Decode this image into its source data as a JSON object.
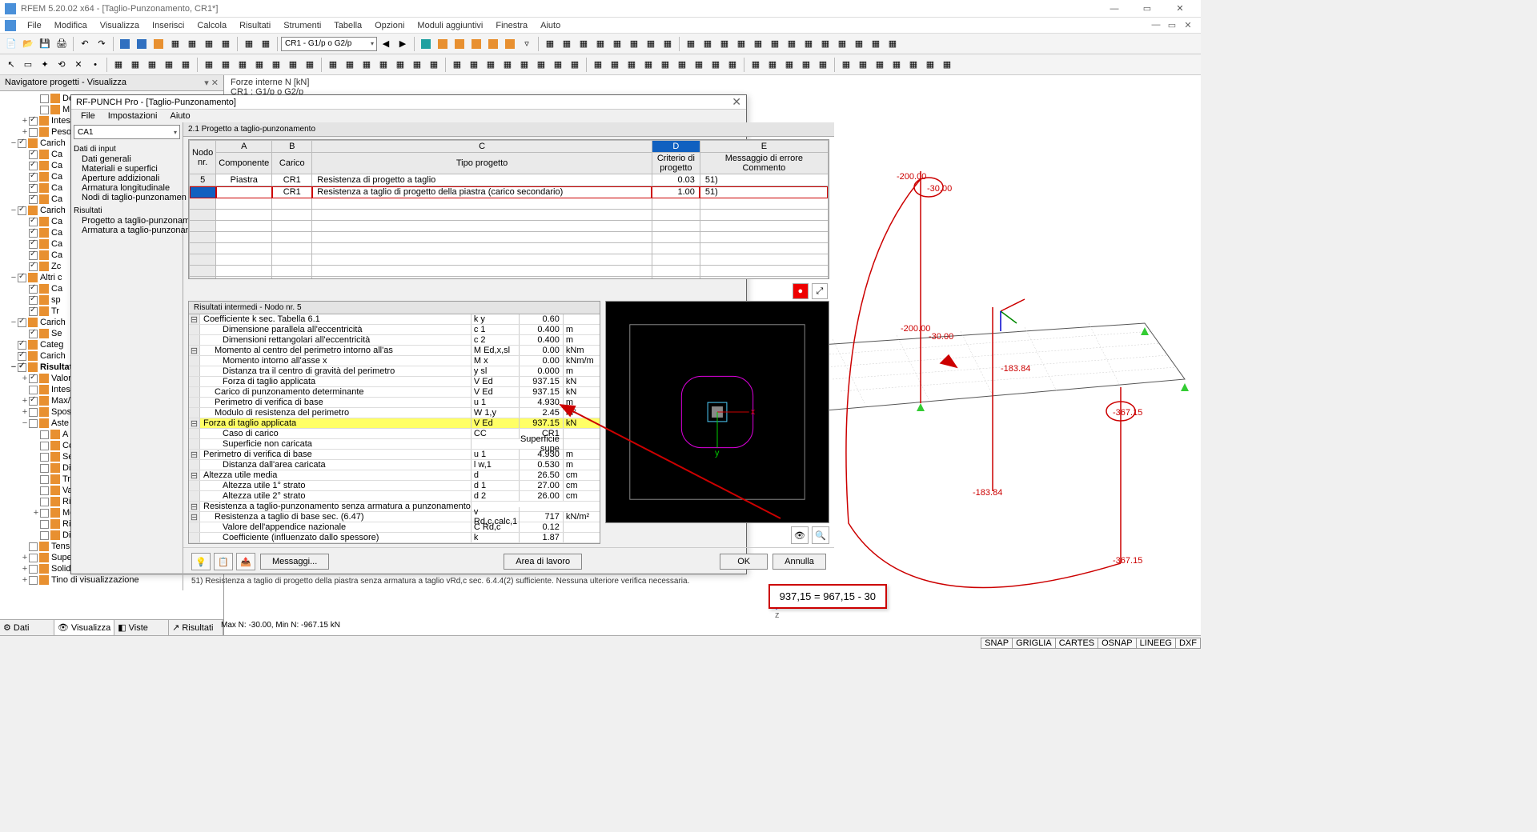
{
  "app": {
    "title": "RFEM 5.20.02 x64 - [Taglio-Punzonamento, CR1*]"
  },
  "menu": [
    "File",
    "Modifica",
    "Visualizza",
    "Inserisci",
    "Calcola",
    "Risultati",
    "Strumenti",
    "Tabella",
    "Opzioni",
    "Moduli aggiuntivi",
    "Finestra",
    "Aiuto"
  ],
  "toolbar_combo": "CR1 - G1/p o G2/p",
  "navigator": {
    "title": "Navigatore progetti - Visualizza",
    "items": [
      {
        "lvl": 2,
        "chk": false,
        "label": "Descrizione dei casi di carico"
      },
      {
        "lvl": 2,
        "chk": false,
        "label": "M"
      },
      {
        "lvl": 1,
        "chk": true,
        "label": "Intest",
        "exp": "+"
      },
      {
        "lvl": 1,
        "chk": false,
        "label": "Peso",
        "exp": "+"
      },
      {
        "lvl": 0,
        "chk": true,
        "label": "Carich",
        "exp": "−"
      },
      {
        "lvl": 1,
        "chk": true,
        "label": "Ca"
      },
      {
        "lvl": 1,
        "chk": true,
        "label": "Ca"
      },
      {
        "lvl": 1,
        "chk": true,
        "label": "Ca"
      },
      {
        "lvl": 1,
        "chk": true,
        "label": "Ca"
      },
      {
        "lvl": 1,
        "chk": true,
        "label": "Ca"
      },
      {
        "lvl": 0,
        "chk": true,
        "label": "Carich",
        "exp": "−"
      },
      {
        "lvl": 1,
        "chk": true,
        "label": "Ca"
      },
      {
        "lvl": 1,
        "chk": true,
        "label": "Ca"
      },
      {
        "lvl": 1,
        "chk": true,
        "label": "Ca"
      },
      {
        "lvl": 1,
        "chk": true,
        "label": "Ca"
      },
      {
        "lvl": 1,
        "chk": true,
        "label": "Zc"
      },
      {
        "lvl": 0,
        "chk": true,
        "label": "Altri c",
        "exp": "−"
      },
      {
        "lvl": 1,
        "chk": true,
        "label": "Ca"
      },
      {
        "lvl": 1,
        "chk": true,
        "label": "sp"
      },
      {
        "lvl": 1,
        "chk": true,
        "label": "Tr"
      },
      {
        "lvl": 0,
        "chk": true,
        "label": "Carich",
        "exp": "−"
      },
      {
        "lvl": 1,
        "chk": true,
        "label": "Se"
      },
      {
        "lvl": 0,
        "chk": true,
        "label": "Categ"
      },
      {
        "lvl": 0,
        "chk": true,
        "label": "Carich"
      },
      {
        "lvl": 0,
        "chk": true,
        "label": "Risultati",
        "bold": true,
        "exp": "−"
      },
      {
        "lvl": 1,
        "chk": true,
        "label": "Valori",
        "exp": "+"
      },
      {
        "lvl": 1,
        "chk": false,
        "label": "Intest"
      },
      {
        "lvl": 1,
        "chk": true,
        "label": "Max/I",
        "exp": "+"
      },
      {
        "lvl": 1,
        "chk": false,
        "label": "Spost",
        "exp": "+"
      },
      {
        "lvl": 1,
        "chk": false,
        "label": "Aste",
        "exp": "−"
      },
      {
        "lvl": 2,
        "chk": false,
        "label": "A",
        "radio": true
      },
      {
        "lvl": 2,
        "chk": false,
        "label": "Cc"
      },
      {
        "lvl": 2,
        "chk": false,
        "label": "Se"
      },
      {
        "lvl": 2,
        "chk": false,
        "label": "Di"
      },
      {
        "lvl": 2,
        "chk": false,
        "label": "Tr"
      },
      {
        "lvl": 2,
        "chk": false,
        "label": "Va"
      },
      {
        "lvl": 2,
        "chk": false,
        "label": "Ri"
      },
      {
        "lvl": 2,
        "chk": false,
        "label": "Me",
        "exp": "+"
      },
      {
        "lvl": 2,
        "chk": false,
        "label": "Ri"
      },
      {
        "lvl": 2,
        "chk": false,
        "label": "Di"
      },
      {
        "lvl": 1,
        "chk": false,
        "label": "Tensioni"
      },
      {
        "lvl": 1,
        "chk": false,
        "label": "Superfici",
        "exp": "+"
      },
      {
        "lvl": 1,
        "chk": false,
        "label": "Solidi",
        "exp": "+"
      },
      {
        "lvl": 1,
        "chk": false,
        "label": "Tino di visualizzazione",
        "exp": "+"
      }
    ],
    "tabs": [
      {
        "icon": "⚙",
        "label": "Dati"
      },
      {
        "icon": "👁",
        "label": "Visualizza",
        "active": true
      },
      {
        "icon": "◧",
        "label": "Viste"
      },
      {
        "icon": "↗",
        "label": "Risultati"
      }
    ]
  },
  "content_header": {
    "line1": "Forze interne N [kN]",
    "line2": "CR1 : G1/p o G2/p"
  },
  "dialog": {
    "title": "RF-PUNCH Pro - [Taglio-Punzonamento]",
    "menu": [
      "File",
      "Impostazioni",
      "Aiuto"
    ],
    "combo": "CA1",
    "tree": {
      "input_header": "Dati di input",
      "input_items": [
        "Dati generali",
        "Materiali e superfici",
        "Aperture addizionali",
        "Armatura longitudinale",
        "Nodi di taglio-punzonamen"
      ],
      "results_header": "Risultati",
      "results_items": [
        "Progetto a taglio-punzonament",
        "Armatura a taglio-punzonamen"
      ]
    },
    "section_title": "2.1 Progetto a taglio-punzonamento",
    "grid": {
      "cols": [
        "A",
        "B",
        "C",
        "D",
        "E"
      ],
      "headers2_left": "Nodo nr.",
      "headers2": [
        "Componente",
        "Carico",
        "Tipo progetto",
        "Criterio di progetto",
        "Messaggio di errore Commento"
      ],
      "rows": [
        {
          "n": "5",
          "comp": "Piastra",
          "car": "CR1",
          "tipo": "Resistenza di progetto a taglio",
          "crit": "0.03",
          "msg": "51)"
        },
        {
          "n": "",
          "comp": "",
          "car": "CR1",
          "tipo": "Resistenza a taglio di progetto della piastra (carico secondario)",
          "crit": "1.00",
          "msg": "51)",
          "red": true
        }
      ]
    },
    "inter_title": "Risultati intermedi - Nodo nr. 5",
    "inter_rows": [
      {
        "exp": "⊟",
        "lbl": "Coefficiente k sec. Tabella 6.1",
        "sym": "k y",
        "val": "0.60",
        "unit": ""
      },
      {
        "lbl": "Dimensione parallela all'eccentricità",
        "sym": "c 1",
        "val": "0.400",
        "unit": "m",
        "ind": 2
      },
      {
        "lbl": "Dimensioni rettangolari all'eccentricità",
        "sym": "c 2",
        "val": "0.400",
        "unit": "m",
        "ind": 2
      },
      {
        "exp": "⊟",
        "lbl": "Momento al centro del perimetro intorno all'as",
        "sym": "M Ed,x,sl",
        "val": "0.00",
        "unit": "kNm",
        "ind": 1
      },
      {
        "lbl": "Momento intorno all'asse x",
        "sym": "M x",
        "val": "0.00",
        "unit": "kNm/m",
        "ind": 2
      },
      {
        "lbl": "Distanza tra il centro di gravità del perimetro",
        "sym": "y sl",
        "val": "0.000",
        "unit": "m",
        "ind": 2
      },
      {
        "lbl": "Forza di taglio applicata",
        "sym": "V Ed",
        "val": "937.15",
        "unit": "kN",
        "ind": 2
      },
      {
        "lbl": "Carico di punzonamento determinante",
        "sym": "V Ed",
        "val": "937.15",
        "unit": "kN",
        "ind": 1
      },
      {
        "lbl": "Perimetro di verifica di base",
        "sym": "u 1",
        "val": "4.930",
        "unit": "m",
        "ind": 1
      },
      {
        "lbl": "Modulo di resistenza del perimetro",
        "sym": "W 1,y",
        "val": "2.45",
        "unit": "m²",
        "ind": 1
      },
      {
        "exp": "⊟",
        "lbl": "Forza di taglio applicata",
        "sym": "V Ed",
        "val": "937.15",
        "unit": "kN",
        "hl": true
      },
      {
        "lbl": "Caso di carico",
        "sym": "CC",
        "val": "CR1",
        "unit": "",
        "ind": 2
      },
      {
        "lbl": "Superficie non caricata",
        "sym": "",
        "val": "Superficie supe",
        "unit": "",
        "ind": 2
      },
      {
        "exp": "⊟",
        "lbl": "Perimetro di verifica di base",
        "sym": "u 1",
        "val": "4.930",
        "unit": "m"
      },
      {
        "lbl": "Distanza dall'area caricata",
        "sym": "l w,1",
        "val": "0.530",
        "unit": "m",
        "ind": 2
      },
      {
        "exp": "⊟",
        "lbl": "Altezza utile media",
        "sym": "d",
        "val": "26.50",
        "unit": "cm"
      },
      {
        "lbl": "Altezza utile 1° strato",
        "sym": "d 1",
        "val": "27.00",
        "unit": "cm",
        "ind": 2
      },
      {
        "lbl": "Altezza utile 2° strato",
        "sym": "d 2",
        "val": "26.00",
        "unit": "cm",
        "ind": 2
      },
      {
        "exp": "⊟",
        "lbl": "Resistenza a taglio-punzonamento senza armatura a punzonamento",
        "sym": "",
        "val": "",
        "unit": ""
      },
      {
        "exp": "⊟",
        "lbl": "Resistenza a taglio di base sec. (6.47)",
        "sym": "v Rd,c,calc,1",
        "val": "717",
        "unit": "kN/m²",
        "ind": 1
      },
      {
        "lbl": "Valore dell'appendice nazionale",
        "sym": "C Rd,c",
        "val": "0.12",
        "unit": "",
        "ind": 2
      },
      {
        "lbl": "Coefficiente (influenzato dallo spessore)",
        "sym": "k",
        "val": "1.87",
        "unit": "",
        "ind": 2
      }
    ],
    "buttons": {
      "messaggi": "Messaggi...",
      "area": "Area di lavoro",
      "ok": "OK",
      "annulla": "Annulla"
    },
    "status": "51) Resistenza a taglio di progetto della piastra senza armatura a taglio vRd,c sec. 6.4.4(2) sufficiente. Nessuna ulteriore verifica necessaria."
  },
  "annotation": "937,15 = 967,15 - 30",
  "viewport_labels": {
    "top": "-200.00",
    "top_circle": "-30.00",
    "mid1": "-200.00",
    "mid2": "-30.00",
    "mid3": "-183.84",
    "right_circle": "-367.15",
    "bot1": "-183.84",
    "bot2": "-367.15"
  },
  "minmax": "Max N: -30.00, Min N: -967.15 kN",
  "statusbar_tags": [
    "SNAP",
    "GRIGLIA",
    "CARTES",
    "OSNAP",
    "LINEEG",
    "DXF"
  ]
}
